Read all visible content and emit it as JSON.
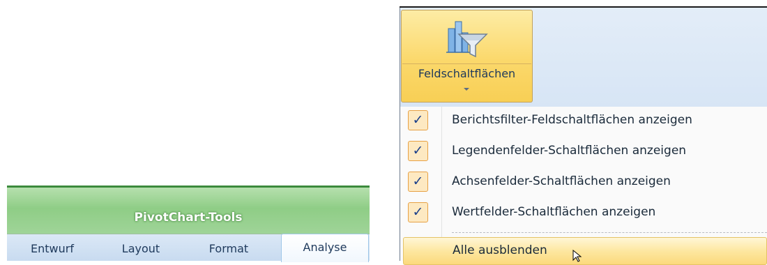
{
  "context_header": {
    "title": "PivotChart-Tools",
    "tabs": [
      {
        "label": "Entwurf",
        "active": false
      },
      {
        "label": "Layout",
        "active": false
      },
      {
        "label": "Format",
        "active": false
      },
      {
        "label": "Analyse",
        "active": true
      }
    ]
  },
  "ribbon": {
    "field_buttons": {
      "label": "Feldschaltflächen",
      "icon": "field-buttons-filter-icon"
    }
  },
  "dropdown": {
    "items": [
      {
        "label": "Berichtsfilter-Feldschaltflächen anzeigen",
        "checked": true
      },
      {
        "label": "Legendenfelder-Schaltflächen anzeigen",
        "checked": true
      },
      {
        "label": "Achsenfelder-Schaltflächen anzeigen",
        "checked": true
      },
      {
        "label": "Wertfelder-Schaltflächen anzeigen",
        "checked": true
      }
    ],
    "hide_all": {
      "label": "Alle ausblenden",
      "hovered": true
    },
    "check_glyph": "✓"
  },
  "colors": {
    "context_green": "#8fcd86",
    "ribbon_blue": "#d7e5f5",
    "button_highlight": "#fbd86b",
    "check_border": "#e7a144"
  }
}
